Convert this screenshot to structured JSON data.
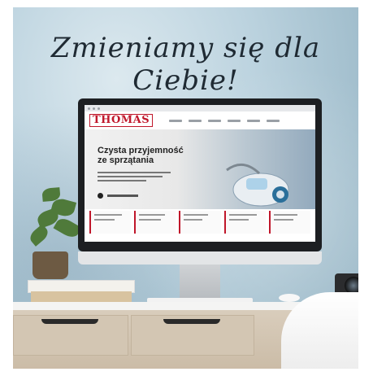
{
  "headline": "Zmieniamy się dla Ciebie!",
  "site": {
    "logo": "THOMAS",
    "hero_title": "Czysta przyjemność ze sprzątania"
  },
  "colors": {
    "brand_red": "#c0172b",
    "wall_blue": "#9fbccb",
    "desk_wood": "#d3c6b3"
  }
}
